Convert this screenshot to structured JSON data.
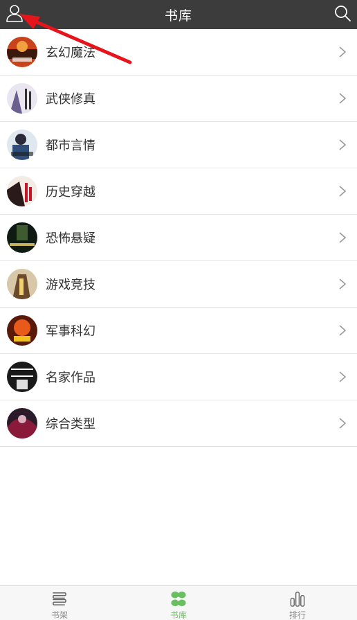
{
  "header": {
    "title": "书库",
    "left_icon": "user-icon",
    "right_icon": "search-icon"
  },
  "categories": [
    {
      "label": "玄幻魔法"
    },
    {
      "label": "武侠修真"
    },
    {
      "label": "都市言情"
    },
    {
      "label": "历史穿越"
    },
    {
      "label": "恐怖悬疑"
    },
    {
      "label": "游戏竞技"
    },
    {
      "label": "军事科幻"
    },
    {
      "label": "名家作品"
    },
    {
      "label": "综合类型"
    }
  ],
  "tabs": [
    {
      "label": "书架",
      "icon": "bookshelf-icon",
      "active": false
    },
    {
      "label": "书库",
      "icon": "library-icon",
      "active": true
    },
    {
      "label": "排行",
      "icon": "ranking-icon",
      "active": false
    }
  ],
  "colors": {
    "header_bg": "#3c3c3c",
    "active_tab": "#6bbf63",
    "annotation_arrow": "#e8141c"
  }
}
